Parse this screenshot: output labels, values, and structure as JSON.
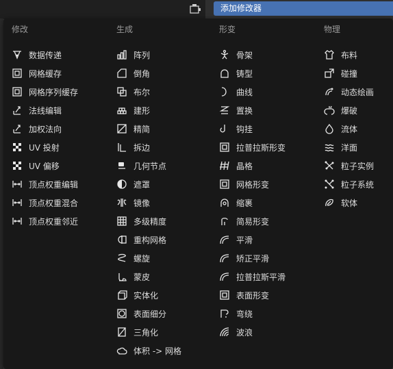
{
  "header": {
    "add_modifier_label": "添加修改器"
  },
  "menu": {
    "columns": [
      {
        "header": "修改",
        "items": [
          {
            "label": "数据传递",
            "icon": "data-transfer-icon"
          },
          {
            "label": "网格缓存",
            "icon": "mesh-cache-icon"
          },
          {
            "label": "网格序列缓存",
            "icon": "mesh-sequence-cache-icon"
          },
          {
            "label": "法线编辑",
            "icon": "normal-edit-icon"
          },
          {
            "label": "加权法向",
            "icon": "weighted-normal-icon"
          },
          {
            "label": "UV 投射",
            "icon": "uv-project-icon"
          },
          {
            "label": "UV 偏移",
            "icon": "uv-warp-icon"
          },
          {
            "label": "顶点权重编辑",
            "icon": "vertex-weight-edit-icon"
          },
          {
            "label": "顶点权重混合",
            "icon": "vertex-weight-mix-icon"
          },
          {
            "label": "顶点权重邻近",
            "icon": "vertex-weight-proximity-icon"
          }
        ]
      },
      {
        "header": "生成",
        "items": [
          {
            "label": "阵列",
            "icon": "array-icon"
          },
          {
            "label": "倒角",
            "icon": "bevel-icon"
          },
          {
            "label": "布尔",
            "icon": "boolean-icon"
          },
          {
            "label": "建形",
            "icon": "build-icon"
          },
          {
            "label": "精简",
            "icon": "decimate-icon"
          },
          {
            "label": "拆边",
            "icon": "edge-split-icon"
          },
          {
            "label": "几何节点",
            "icon": "geometry-nodes-icon"
          },
          {
            "label": "遮罩",
            "icon": "mask-icon"
          },
          {
            "label": "镜像",
            "icon": "mirror-icon"
          },
          {
            "label": "多级精度",
            "icon": "multires-icon"
          },
          {
            "label": "重构网格",
            "icon": "remesh-icon"
          },
          {
            "label": "螺旋",
            "icon": "screw-icon"
          },
          {
            "label": "蒙皮",
            "icon": "skin-icon"
          },
          {
            "label": "实体化",
            "icon": "solidify-icon"
          },
          {
            "label": "表面细分",
            "icon": "subdivision-icon"
          },
          {
            "label": "三角化",
            "icon": "triangulate-icon"
          },
          {
            "label": "体积 -> 网格",
            "icon": "volume-to-mesh-icon"
          }
        ]
      },
      {
        "header": "形变",
        "items": [
          {
            "label": "骨架",
            "icon": "armature-icon"
          },
          {
            "label": "铸型",
            "icon": "cast-icon"
          },
          {
            "label": "曲线",
            "icon": "curve-icon"
          },
          {
            "label": "置换",
            "icon": "displace-icon"
          },
          {
            "label": "钩挂",
            "icon": "hook-icon"
          },
          {
            "label": "拉普拉斯形变",
            "icon": "laplacian-deform-icon"
          },
          {
            "label": "晶格",
            "icon": "lattice-icon"
          },
          {
            "label": "网格形变",
            "icon": "mesh-deform-icon"
          },
          {
            "label": "缩裹",
            "icon": "shrinkwrap-icon"
          },
          {
            "label": "简易形变",
            "icon": "simple-deform-icon"
          },
          {
            "label": "平滑",
            "icon": "smooth-icon"
          },
          {
            "label": "矫正平滑",
            "icon": "corrective-smooth-icon"
          },
          {
            "label": "拉普拉斯平滑",
            "icon": "laplacian-smooth-icon"
          },
          {
            "label": "表面形变",
            "icon": "surface-deform-icon"
          },
          {
            "label": "弯绕",
            "icon": "warp-icon"
          },
          {
            "label": "波浪",
            "icon": "wave-icon"
          }
        ]
      },
      {
        "header": "物理",
        "items": [
          {
            "label": "布料",
            "icon": "cloth-icon"
          },
          {
            "label": "碰撞",
            "icon": "collision-icon"
          },
          {
            "label": "动态绘画",
            "icon": "dynamic-paint-icon"
          },
          {
            "label": "爆破",
            "icon": "explode-icon"
          },
          {
            "label": "流体",
            "icon": "fluid-icon"
          },
          {
            "label": "洋面",
            "icon": "ocean-icon"
          },
          {
            "label": "粒子实例",
            "icon": "particle-instance-icon"
          },
          {
            "label": "粒子系统",
            "icon": "particle-system-icon"
          },
          {
            "label": "软体",
            "icon": "soft-body-icon"
          }
        ]
      }
    ]
  }
}
